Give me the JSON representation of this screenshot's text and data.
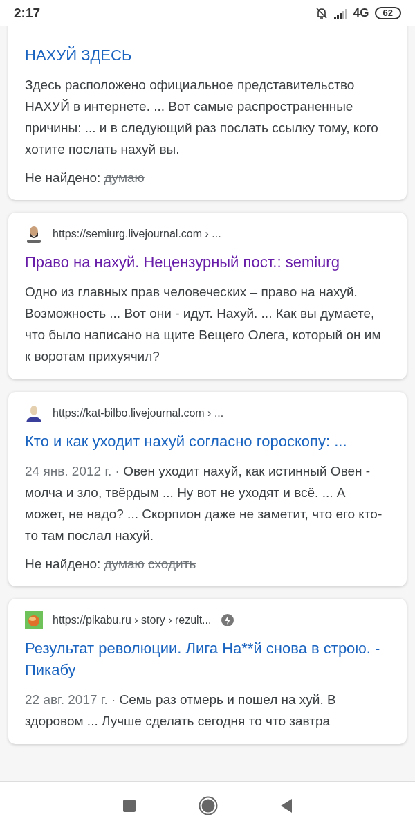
{
  "status_bar": {
    "time": "2:17",
    "network": "4G",
    "battery": "62"
  },
  "results": [
    {
      "amp": false,
      "title": "НАХУЙ ЗДЕСЬ",
      "visited": false,
      "snippet": "Здесь расположено официальное представительство НАХУЙ в интернете. ... Вот самые распространенные причины: ... и в следующий раз послать ссылку тому, кого хотите послать нахуй вы.",
      "missing_label": "Не найдено:",
      "missing": [
        "думаю"
      ]
    },
    {
      "kind": "bearded",
      "url": "https://semiurg.livejournal.com › ...",
      "amp": false,
      "title": "Право на нахуй. Нецензурный пост.: semiurg",
      "visited": true,
      "snippet": "Одно из главных прав человеческих – право на нахуй. Возможность ... Вот они - идут. Нахуй. ... Как вы думаете, что было написано на щите Вещего Олега, который он им к воротам прихуячил?"
    },
    {
      "kind": "person",
      "url": "https://kat-bilbo.livejournal.com › ...",
      "amp": false,
      "title": "Кто и как уходит нахуй согласно гороскопу: ...",
      "visited": false,
      "date": "24 янв. 2012 г. · ",
      "snippet": "Овен уходит нахуй, как истинный Овен - молча и зло, твёрдым ... Ну вот не уходят и всё. ... А может, не надо? ... Скорпион даже не заметит, что его кто-то там послал нахуй.",
      "missing_label": "Не найдено:",
      "missing": [
        "думаю",
        "сходить"
      ]
    },
    {
      "kind": "pikabu",
      "url": "https://pikabu.ru › story › rezult...",
      "amp": true,
      "title": "Результат революции. Лига На**й снова в строю. - Пикабу",
      "visited": false,
      "date": "22 авг. 2017 г. · ",
      "snippet": "Семь раз отмерь и пошел на хуй. В здоровом ... Лучше сделать сегодня то что завтра"
    }
  ]
}
